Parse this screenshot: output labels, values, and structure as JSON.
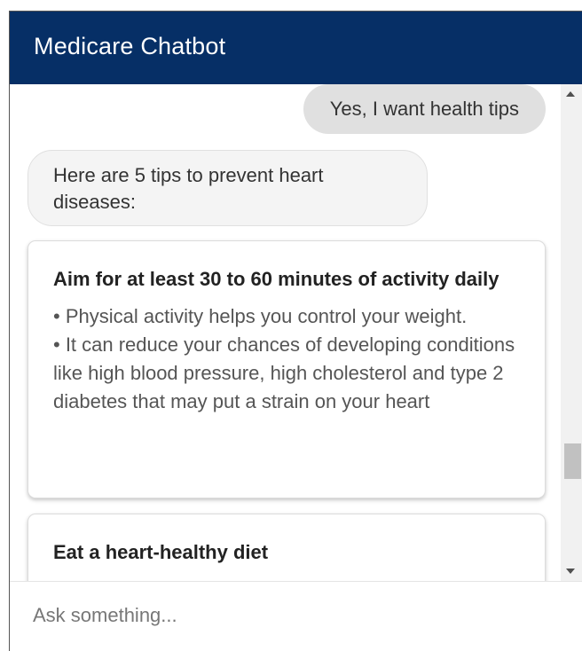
{
  "header": {
    "title": "Medicare Chatbot"
  },
  "conversation": {
    "user_message": "Yes, I want health tips",
    "bot_message": "Here are 5 tips to prevent heart diseases:",
    "tips": [
      {
        "title": "Aim for at least 30 to 60 minutes of activity daily",
        "bullets": [
          "• Physical activity helps you control your weight.",
          "• It can reduce your chances of developing conditions like high blood pressure, high cholesterol and type 2 diabetes that may put a strain on your heart"
        ]
      },
      {
        "title": "Eat a heart-healthy diet",
        "bullets": []
      }
    ]
  },
  "input": {
    "placeholder": "Ask something...",
    "value": ""
  },
  "colors": {
    "header_background": "#062f66",
    "header_text": "#ffffff",
    "user_bubble": "#e0e0e0",
    "bot_bubble": "#f4f4f4"
  },
  "icons": {
    "scroll_up": "scroll-up-arrow-icon",
    "scroll_down": "scroll-down-arrow-icon"
  }
}
